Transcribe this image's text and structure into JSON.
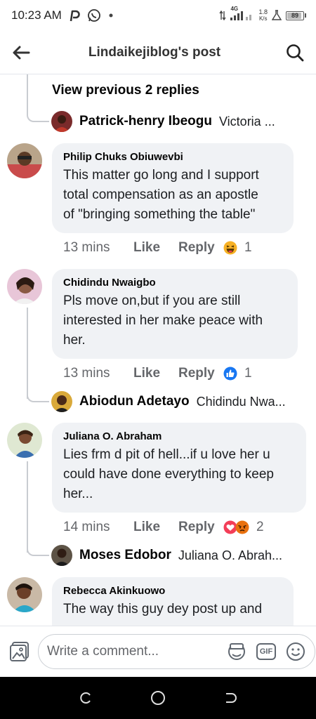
{
  "status_bar": {
    "time": "10:23 AM",
    "network": "4G",
    "speed_value": "1.8",
    "speed_unit": "K/s",
    "battery": "89"
  },
  "header": {
    "title": "Lindaikejiblog's post"
  },
  "thread": {
    "view_previous": "View previous 2 replies",
    "first_reply": {
      "name": "Patrick-henry Ibeogu",
      "snippet": "Victoria ..."
    }
  },
  "comments": [
    {
      "name": "Philip Chuks Obiuwevbi",
      "lines": [
        "This matter go long and I support",
        "total compensation as an apostle",
        "of \"bringing something the table\""
      ],
      "time": "13 mins",
      "like": "Like",
      "reply": "Reply",
      "reactions": [
        "haha"
      ],
      "reaction_count": "1"
    },
    {
      "name": "Chidindu Nwaigbo",
      "lines": [
        "Pls move on,but if you are still",
        "interested in her make peace with",
        "her."
      ],
      "time": "13 mins",
      "like": "Like",
      "reply": "Reply",
      "reactions": [
        "like"
      ],
      "reaction_count": "1",
      "reply_preview": {
        "name": "Abiodun Adetayo",
        "snippet": "Chidindu Nwa..."
      }
    },
    {
      "name": "Juliana O. Abraham",
      "lines": [
        "Lies frm d pit of hell...if u love her u",
        "could have done everything to keep",
        "her..."
      ],
      "time": "14 mins",
      "like": "Like",
      "reply": "Reply",
      "reactions": [
        "love",
        "angry"
      ],
      "reaction_count": "2",
      "reply_preview": {
        "name": "Moses Edobor",
        "snippet": "Juliana O. Abrah..."
      }
    },
    {
      "name": "Rebecca Akinkuowo",
      "lines": [
        "The way this guy dey post up and"
      ]
    }
  ],
  "composer": {
    "placeholder": "Write a comment...",
    "gif_label": "GIF"
  },
  "colors": {
    "like_blue": "#1877f2",
    "love_red": "#f33e58",
    "angry_orange": "#e9710f",
    "haha_yellow": "#f7b125",
    "bubble_bg": "#f0f2f5",
    "meta_gray": "#65676b"
  }
}
